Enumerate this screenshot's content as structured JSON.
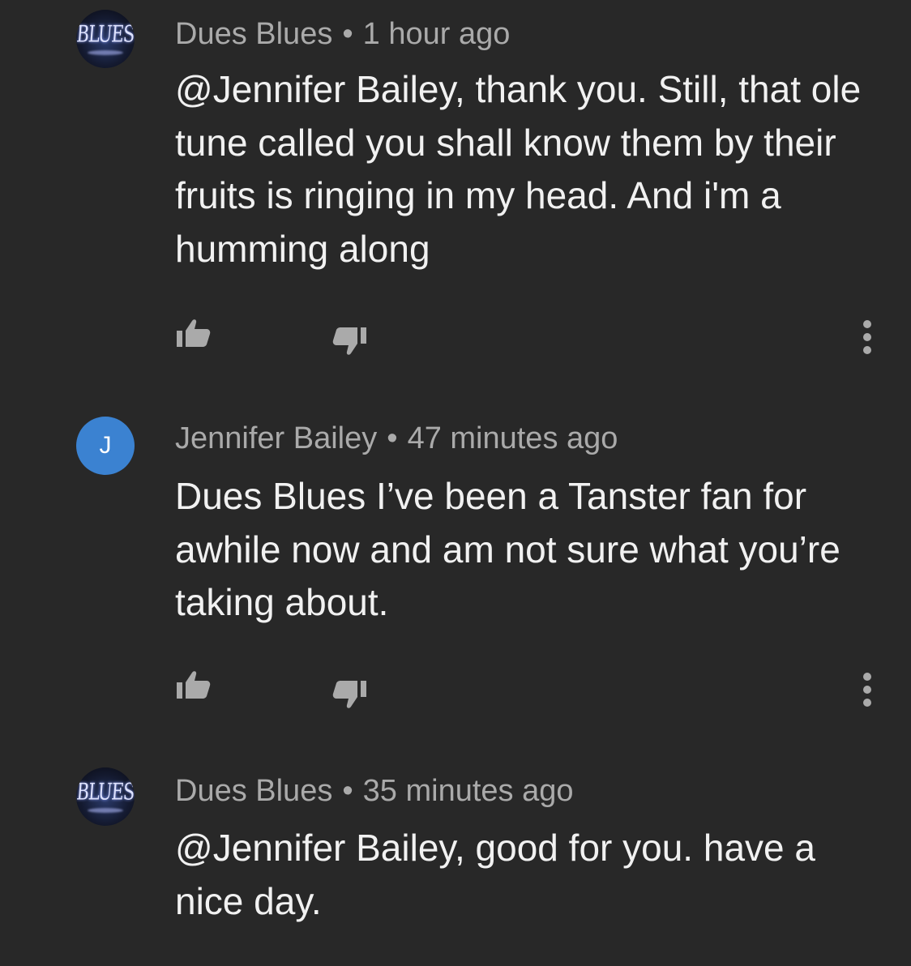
{
  "comments": [
    {
      "author": "Dues Blues",
      "separator": "•",
      "time": "1 hour ago",
      "text": "@Jennifer Bailey, thank you. Still, that ole tune called you shall know them by their fruits is ringing in my head. And i'm a humming along",
      "avatar": {
        "type": "image",
        "image_text": "BLUES"
      }
    },
    {
      "author": "Jennifer Bailey",
      "separator": "•",
      "time": "47 minutes ago",
      "text": "Dues Blues I’ve been a Tanster fan for awhile now and am not sure what you’re taking about.",
      "avatar": {
        "type": "initial",
        "initial": "J",
        "color": "#3b82d1"
      }
    },
    {
      "author": "Dues Blues",
      "separator": "•",
      "time": "35 minutes ago",
      "text": "@Jennifer Bailey, good for you. have a nice day.",
      "avatar": {
        "type": "image",
        "image_text": "BLUES"
      }
    }
  ],
  "icons": {
    "like": "thumbs-up-icon",
    "dislike": "thumbs-down-icon",
    "more": "more-vertical-icon"
  },
  "colors": {
    "background": "#282828",
    "text_primary": "#f1f1f1",
    "text_secondary": "#aaaaaa",
    "icon": "#aaaaaa"
  }
}
